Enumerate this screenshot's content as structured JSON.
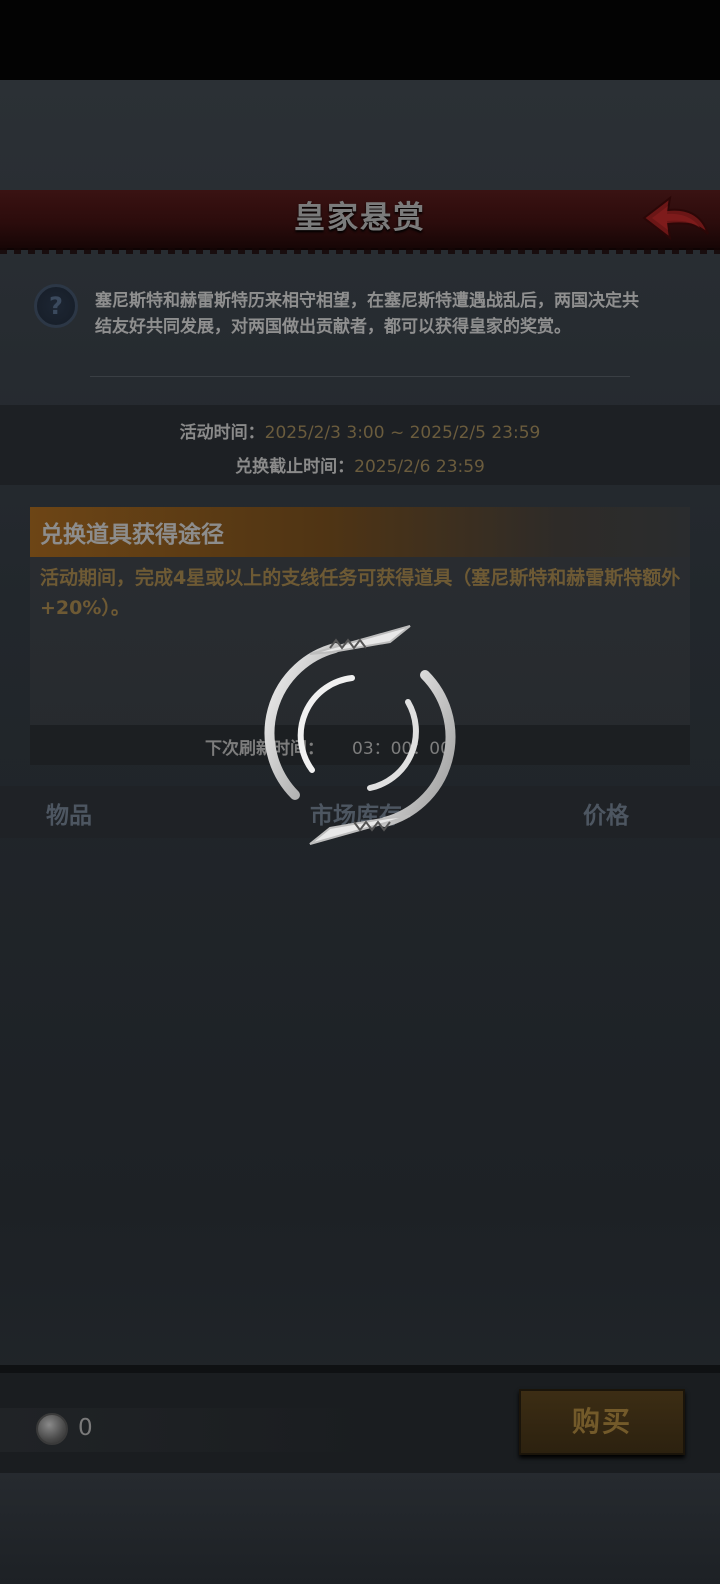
{
  "header": {
    "title": "皇家悬赏"
  },
  "intro": {
    "text": "塞尼斯特和赫雷斯特历来相守相望，在塞尼斯特遭遇战乱后，两国决定共结友好共同发展，对两国做出贡献者，都可以获得皇家的奖赏。"
  },
  "event_time": {
    "activity_label": "活动时间：",
    "activity_value": "2025/2/3 3:00 ~ 2025/2/5 23:59",
    "deadline_label": "兑换截止时间：",
    "deadline_value": "2025/2/6 23:59"
  },
  "exchange_panel": {
    "title": "兑换道具获得途径",
    "description": "活动期间，完成4星或以上的支线任务可获得道具（塞尼斯特和赫雷斯特额外+20%）。",
    "refresh_label": "下次刷新时间：",
    "refresh_value": "03：00：00"
  },
  "table": {
    "col_item": "物品",
    "col_stock": "市场库存",
    "col_price": "价格"
  },
  "footer": {
    "currency_count": "0",
    "buy_label": "购买"
  },
  "colors": {
    "title_banner": "#3a1212",
    "accent_gold": "#6b5c3d",
    "back_arrow": "#6b1616"
  },
  "icons": [
    "back-arrow-icon",
    "help-icon",
    "coin-icon",
    "loading-spinner-icon"
  ]
}
